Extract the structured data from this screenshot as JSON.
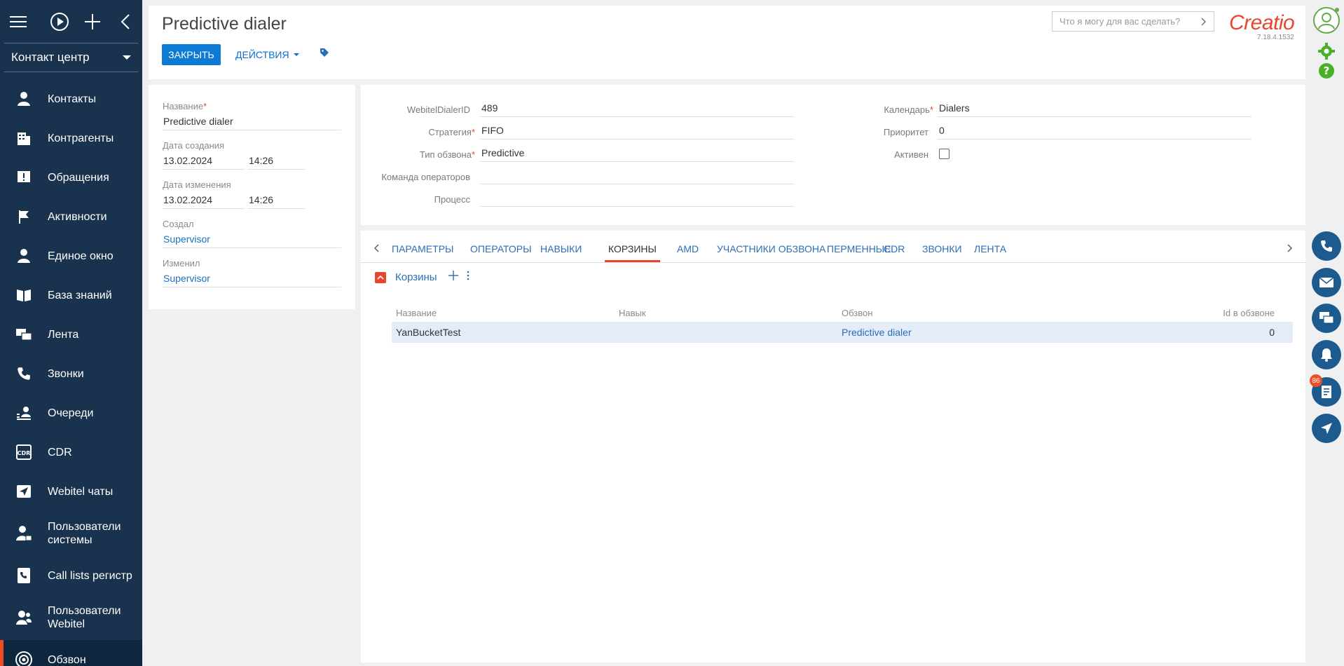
{
  "sidebar": {
    "workplace": "Контакт центр",
    "items": [
      {
        "label": "Контакты",
        "icon": "person-icon"
      },
      {
        "label": "Контрагенты",
        "icon": "building-icon"
      },
      {
        "label": "Обращения",
        "icon": "case-icon"
      },
      {
        "label": "Активности",
        "icon": "flag-icon"
      },
      {
        "label": "Единое окно",
        "icon": "user-desk-icon"
      },
      {
        "label": "База знаний",
        "icon": "book-icon"
      },
      {
        "label": "Лента",
        "icon": "feed-icon"
      },
      {
        "label": "Звонки",
        "icon": "phone-icon"
      },
      {
        "label": "Очереди",
        "icon": "queue-icon"
      },
      {
        "label": "CDR",
        "icon": "cdr-icon"
      },
      {
        "label": "Webitel чаты",
        "icon": "chat-send-icon"
      },
      {
        "label": "Пользователи системы",
        "icon": "user-lock-icon"
      },
      {
        "label": "Call lists регистр",
        "icon": "call-list-icon"
      },
      {
        "label": "Пользователи Webitel",
        "icon": "users-icon"
      },
      {
        "label": "Обзвон",
        "icon": "dialer-icon",
        "active": true
      }
    ]
  },
  "header": {
    "title": "Predictive dialer",
    "close_label": "ЗАКРЫТЬ",
    "actions_label": "ДЕЙСТВИЯ",
    "search_placeholder": "Что я могу для вас сделать?",
    "logo": "Creatio",
    "version": "7.18.4.1532"
  },
  "left_panel": {
    "name_label": "Название",
    "name_value": "Predictive dialer",
    "created_label": "Дата создания",
    "created_date": "13.02.2024",
    "created_time": "14:26",
    "modified_label": "Дата изменения",
    "modified_date": "13.02.2024",
    "modified_time": "14:26",
    "created_by_label": "Создал",
    "created_by": "Supervisor",
    "modified_by_label": "Изменил",
    "modified_by": "Supervisor"
  },
  "fields": {
    "dialer_id_label": "WebitelDialerID",
    "dialer_id": "489",
    "strategy_label": "Стратегия",
    "strategy": "FIFO",
    "type_label": "Тип обзвона",
    "type": "Predictive",
    "team_label": "Команда операторов",
    "team": "",
    "process_label": "Процесс",
    "process": "",
    "calendar_label": "Календарь",
    "calendar": "Dialers",
    "priority_label": "Приоритет",
    "priority": "0",
    "active_label": "Активен",
    "active": false
  },
  "tabs": {
    "items": [
      "ПАРАМЕТРЫ",
      "ОПЕРАТОРЫ",
      "НАВЫКИ",
      "КОРЗИНЫ",
      "AMD",
      "УЧАСТНИКИ ОБЗВОНА",
      "ПЕРМЕННЫЕ",
      "CDR",
      "ЗВОНКИ",
      "ЛЕНТА"
    ],
    "active": "КОРЗИНЫ"
  },
  "detail": {
    "title": "Корзины",
    "columns": [
      "Название",
      "Навык",
      "Обзвон",
      "Id в обзвоне"
    ],
    "rows": [
      {
        "name": "YanBucketTest",
        "skill": "",
        "dialer": "Predictive dialer",
        "id": "0"
      }
    ]
  },
  "rail": {
    "notification_count": "86",
    "accent": "#1d5a8d"
  },
  "colors": {
    "sidebar_bg": "#19334e",
    "primary_button": "#0d7bd6",
    "accent_red": "#e8462b",
    "link": "#2b6eb6"
  }
}
